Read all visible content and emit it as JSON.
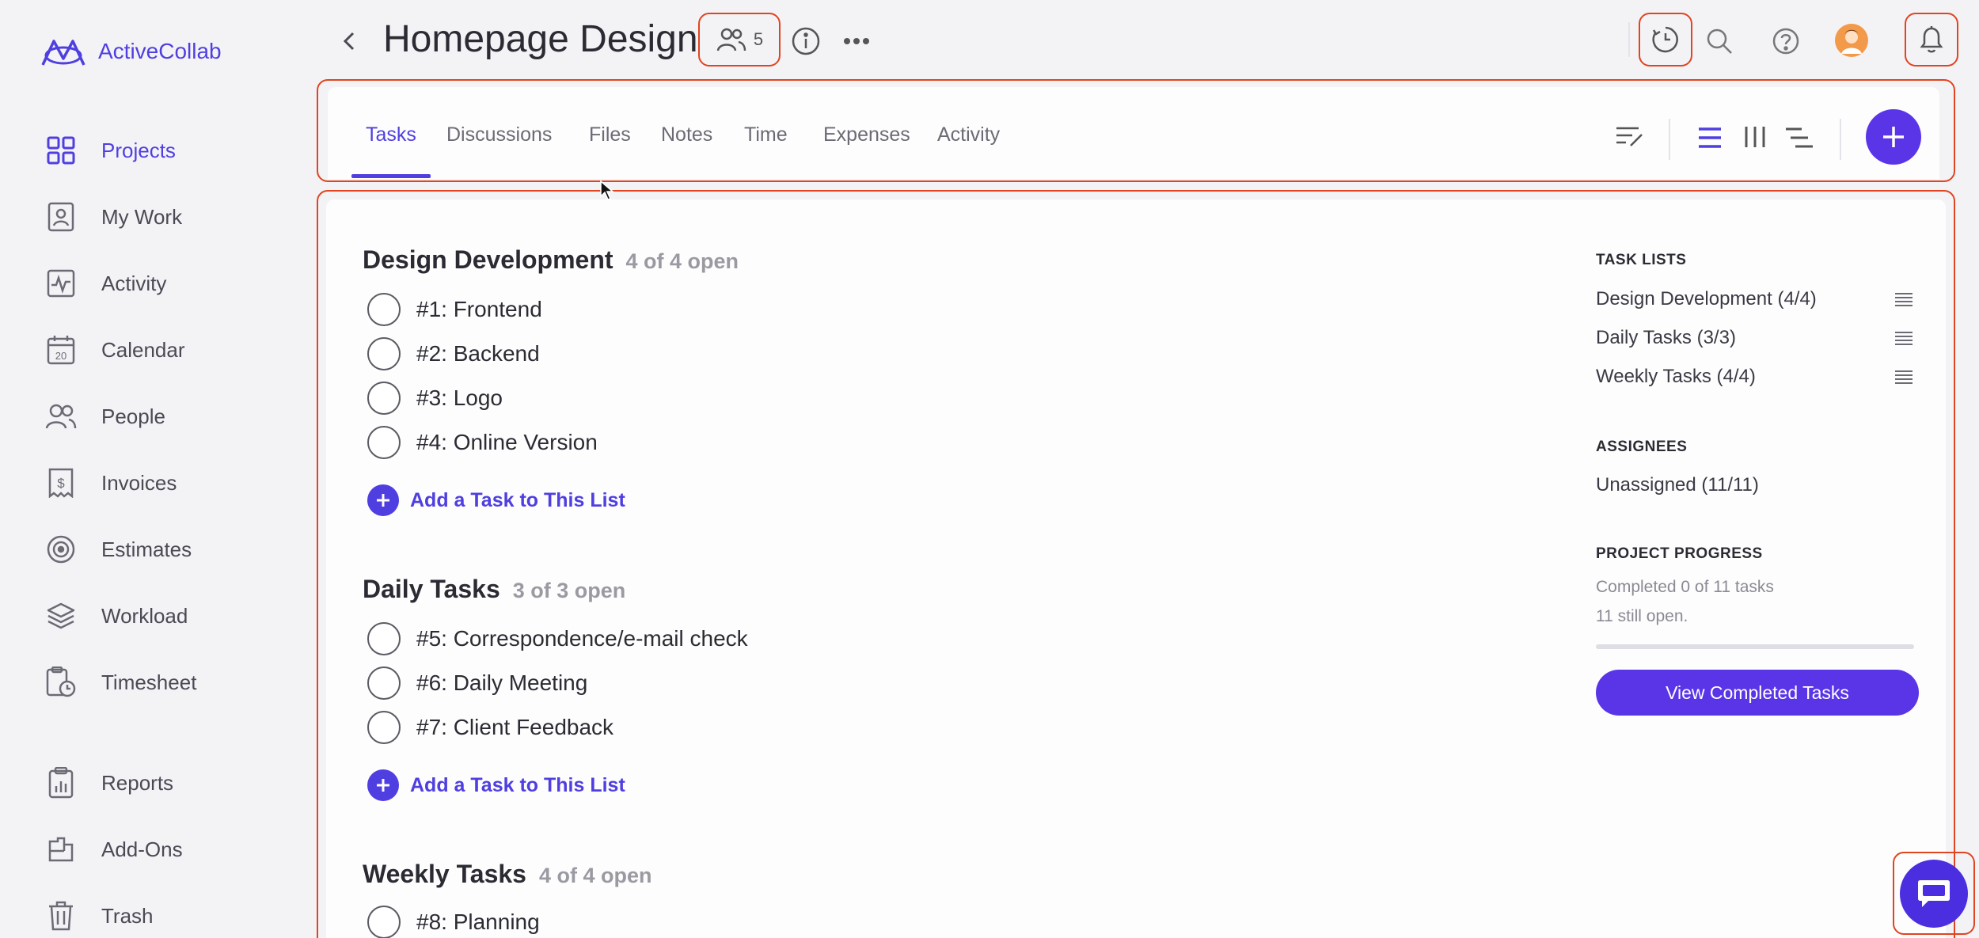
{
  "app": {
    "name": "ActiveCollab"
  },
  "sidebar": {
    "items": [
      {
        "label": "Projects",
        "icon": "grid-icon",
        "active": true
      },
      {
        "label": "My Work",
        "icon": "user-card-icon"
      },
      {
        "label": "Activity",
        "icon": "activity-icon"
      },
      {
        "label": "Calendar",
        "icon": "calendar-icon",
        "day": "20"
      },
      {
        "label": "People",
        "icon": "people-icon"
      },
      {
        "label": "Invoices",
        "icon": "invoice-icon"
      },
      {
        "label": "Estimates",
        "icon": "target-icon"
      },
      {
        "label": "Workload",
        "icon": "layers-icon"
      },
      {
        "label": "Timesheet",
        "icon": "timesheet-icon"
      },
      {
        "label": "Reports",
        "icon": "reports-icon"
      },
      {
        "label": "Add-Ons",
        "icon": "addons-icon"
      },
      {
        "label": "Trash",
        "icon": "trash-icon"
      }
    ]
  },
  "header": {
    "title": "Homepage Design",
    "members_count": "5"
  },
  "tabs": [
    {
      "label": "Tasks",
      "active": true
    },
    {
      "label": "Discussions"
    },
    {
      "label": "Files"
    },
    {
      "label": "Notes"
    },
    {
      "label": "Time"
    },
    {
      "label": "Expenses"
    },
    {
      "label": "Activity"
    }
  ],
  "groups": [
    {
      "name": "Design Development",
      "count": "4 of 4 open",
      "tasks": [
        "#1: Frontend",
        "#2: Backend",
        "#3: Logo",
        "#4: Online Version"
      ],
      "add_label": "Add a Task to This List"
    },
    {
      "name": "Daily Tasks",
      "count": "3 of 3 open",
      "tasks": [
        "#5: Correspondence/e-mail check",
        "#6: Daily Meeting",
        "#7: Client Feedback"
      ],
      "add_label": "Add a Task to This List"
    },
    {
      "name": "Weekly Tasks",
      "count": "4 of 4 open",
      "tasks": [
        "#8: Planning"
      ]
    }
  ],
  "right_panel": {
    "task_lists_heading": "TASK LISTS",
    "task_lists": [
      "Design Development (4/4)",
      "Daily Tasks (3/3)",
      "Weekly Tasks (4/4)"
    ],
    "assignees_heading": "ASSIGNEES",
    "assignees": [
      "Unassigned (11/11)"
    ],
    "progress_heading": "PROJECT PROGRESS",
    "progress_line1": "Completed 0 of 11 tasks",
    "progress_line2": "11 still open.",
    "progress_fraction": 0,
    "view_completed_label": "View Completed Tasks"
  },
  "colors": {
    "accent": "#4f3fe0",
    "button": "#5a35e8",
    "highlight": "#e04420",
    "background": "#f3f3f6"
  }
}
